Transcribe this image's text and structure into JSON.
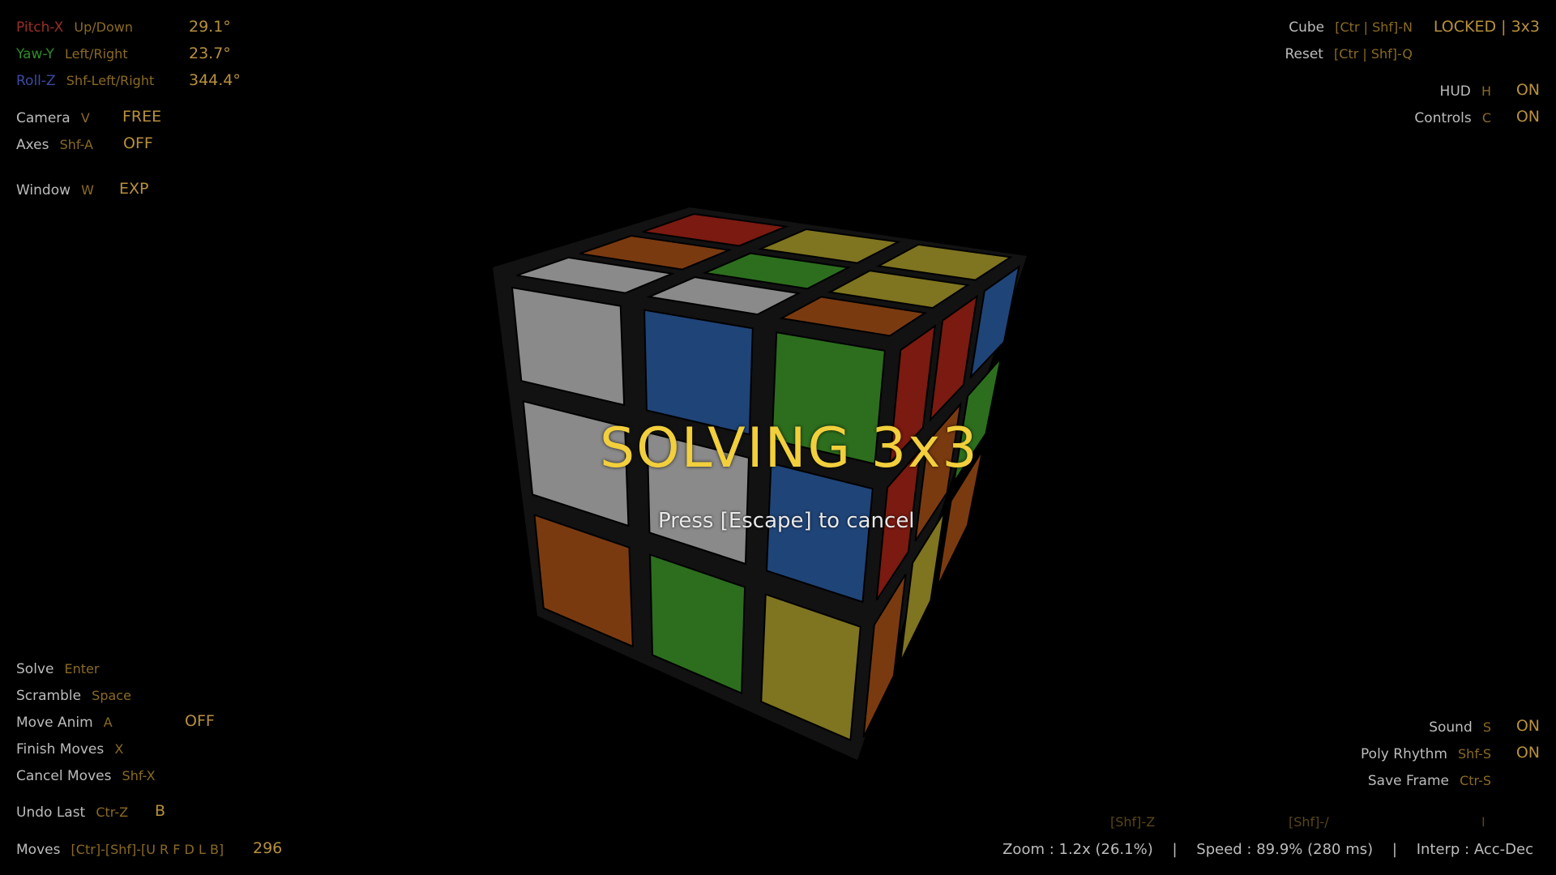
{
  "rotation": {
    "pitch": {
      "axis": "Pitch-X",
      "keys": "Up/Down",
      "value": "29.1°"
    },
    "yaw": {
      "axis": "Yaw-Y",
      "keys": "Left/Right",
      "value": "23.7°"
    },
    "roll": {
      "axis": "Roll-Z",
      "keys": "Shf-Left/Right",
      "value": "344.4°"
    }
  },
  "view": {
    "camera": {
      "label": "Camera",
      "key": "V",
      "value": "FREE"
    },
    "axes": {
      "label": "Axes",
      "key": "Shf-A",
      "value": "OFF"
    },
    "window": {
      "label": "Window",
      "key": "W",
      "value": "EXP"
    }
  },
  "cube_controls": {
    "cube": {
      "label": "Cube",
      "keys": "[Ctr | Shf]-N",
      "status": "LOCKED | 3x3"
    },
    "reset": {
      "label": "Reset",
      "keys": "[Ctr | Shf]-Q"
    },
    "hud": {
      "label": "HUD",
      "key": "H",
      "value": "ON"
    },
    "controls": {
      "label": "Controls",
      "key": "C",
      "value": "ON"
    }
  },
  "actions": {
    "solve": {
      "label": "Solve",
      "key": "Enter"
    },
    "scramble": {
      "label": "Scramble",
      "key": "Space"
    },
    "move_anim": {
      "label": "Move Anim",
      "key": "A",
      "value": "OFF"
    },
    "finish_moves": {
      "label": "Finish Moves",
      "key": "X"
    },
    "cancel_moves": {
      "label": "Cancel Moves",
      "key": "Shf-X"
    },
    "undo_last": {
      "label": "Undo Last",
      "key": "Ctr-Z",
      "value": "B"
    },
    "moves": {
      "label": "Moves",
      "key": "[Ctr]-[Shf]-[U R F D L B]",
      "value": "296"
    }
  },
  "audio": {
    "sound": {
      "label": "Sound",
      "key": "S",
      "value": "ON"
    },
    "poly_rhythm": {
      "label": "Poly Rhythm",
      "key": "Shf-S",
      "value": "ON"
    },
    "save_frame": {
      "label": "Save Frame",
      "key": "Ctr-S"
    }
  },
  "hints": {
    "zoom_key": "[Shf]-Z",
    "speed_key": "[Shf]-/",
    "interp_key": "I"
  },
  "status": {
    "zoom": "Zoom : 1.2x (26.1%)",
    "separator": "|",
    "speed": "Speed : 89.9% (280 ms)",
    "interp": "Interp : Acc-Dec"
  },
  "overlay": {
    "title": "SOLVING  3x3",
    "subtitle": "Press [Escape] to cancel"
  },
  "cube_state": {
    "top": [
      "red",
      "yellow",
      "yellow",
      "orange",
      "green",
      "yellow",
      "gray",
      "gray",
      "orange"
    ],
    "front": [
      "gray",
      "blue",
      "green",
      "gray",
      "gray",
      "blue",
      "orange",
      "green",
      "yellow"
    ],
    "right": [
      "red",
      "red",
      "blue",
      "red",
      "orange",
      "green",
      "orange",
      "yellow",
      "orange"
    ]
  },
  "colors": {
    "red": "#7a1a10",
    "yellow": "#7f7420",
    "orange": "#7a3a10",
    "green": "#2c6e1e",
    "gray": "#8a8a8a",
    "blue": "#1f4478",
    "body": "#121212",
    "accent": "#f2cf3c"
  }
}
